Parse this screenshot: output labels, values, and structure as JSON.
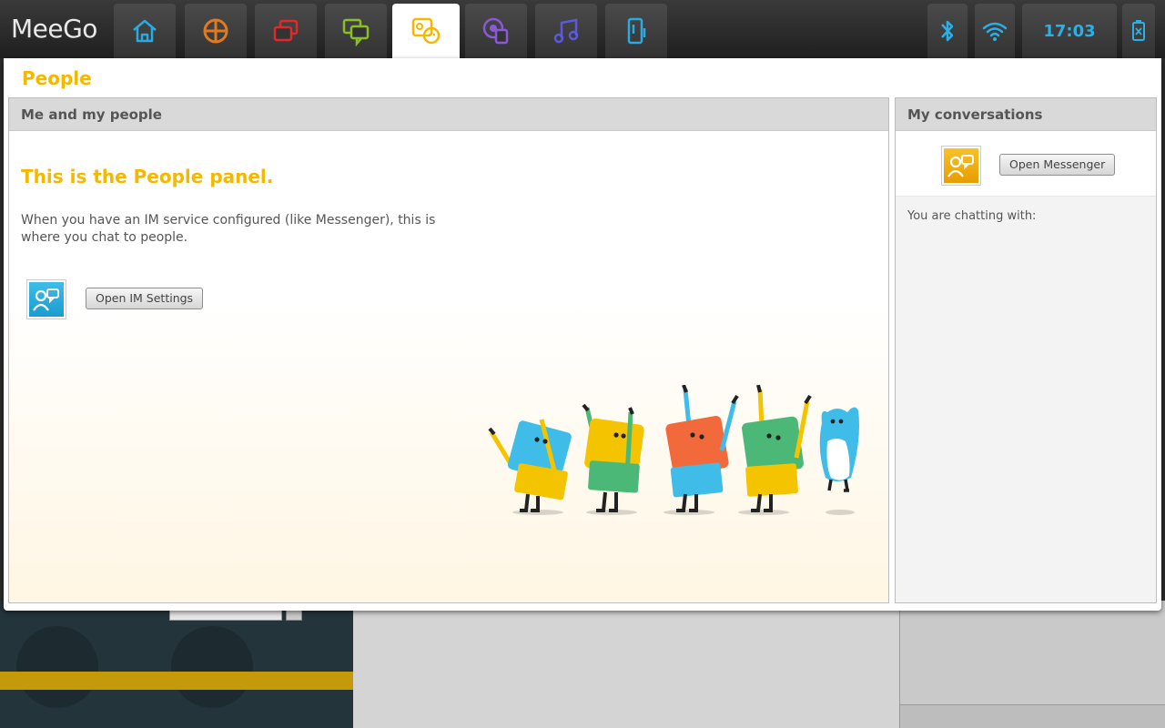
{
  "topbar": {
    "logo": "MeeGo",
    "tabs": [
      {
        "name": "home",
        "icon": "home-icon",
        "color": "#29abe2"
      },
      {
        "name": "applications",
        "icon": "apps-icon",
        "color": "#e07a1f"
      },
      {
        "name": "zones",
        "icon": "zones-icon",
        "color": "#e02a2a"
      },
      {
        "name": "status",
        "icon": "status-icon",
        "color": "#8cbf26"
      },
      {
        "name": "people",
        "icon": "people-icon",
        "color": "#f5b800",
        "active": true
      },
      {
        "name": "internet",
        "icon": "internet-icon",
        "color": "#8a5ad6"
      },
      {
        "name": "media",
        "icon": "music-icon",
        "color": "#5a5ae0"
      },
      {
        "name": "devices",
        "icon": "device-icon",
        "color": "#29abe2"
      }
    ],
    "status": {
      "bluetooth_icon": "bluetooth-icon",
      "wifi_icon": "wifi-icon",
      "time": "17:03",
      "battery_icon": "battery-icon"
    }
  },
  "window": {
    "title": "People",
    "left_pane": {
      "header": "Me and my people",
      "headline": "This is the People panel.",
      "description": "When you have an IM service configured (like Messenger), this is where you chat to people.",
      "button": "Open IM Settings"
    },
    "right_pane": {
      "header": "My conversations",
      "button": "Open Messenger",
      "chatting_label": "You are chatting with:"
    }
  },
  "colors": {
    "accent": "#f5b800",
    "clock": "#2ab0e6"
  }
}
